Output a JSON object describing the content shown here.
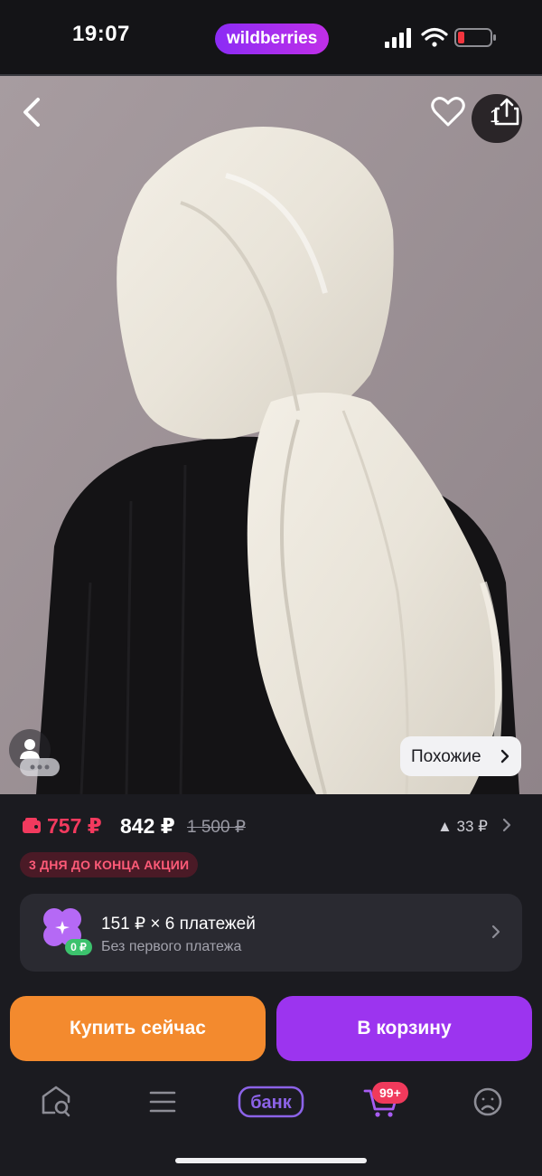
{
  "status_bar": {
    "time": "19:07",
    "brand": "wildberries",
    "icons": [
      "signal-icon",
      "wifi-icon",
      "battery-low-icon"
    ]
  },
  "product_image": {
    "share_count": "1",
    "similar_label": "Похожие",
    "icons": [
      "back-arrow-icon",
      "heart-icon",
      "share-icon",
      "person-icon",
      "chevron-right-icon"
    ]
  },
  "price": {
    "wallet_price": "757 ₽",
    "price": "842 ₽",
    "old_price": "1 500 ₽",
    "delta": "▲ 33 ₽",
    "colors": {
      "wallet": "#f23a5e",
      "old": "#9a9aa4"
    }
  },
  "promo": {
    "label": "3 ДНЯ ДО КОНЦА АКЦИИ"
  },
  "installment": {
    "title": "151 ₽ × 6 платежей",
    "subtitle": "Без первого платежа",
    "badge": "0 ₽",
    "icon": "clover-icon"
  },
  "actions": {
    "buy_now": "Купить сейчас",
    "add_to_cart": "В корзину",
    "colors": {
      "buy": "#f38a2e",
      "cart": "#9c34ef"
    }
  },
  "tab_bar": {
    "items": [
      "home-search-icon",
      "catalog-icon",
      "bank-icon",
      "cart-icon",
      "profile-icon"
    ],
    "bank_label": "банк",
    "cart_badge": "99+"
  }
}
